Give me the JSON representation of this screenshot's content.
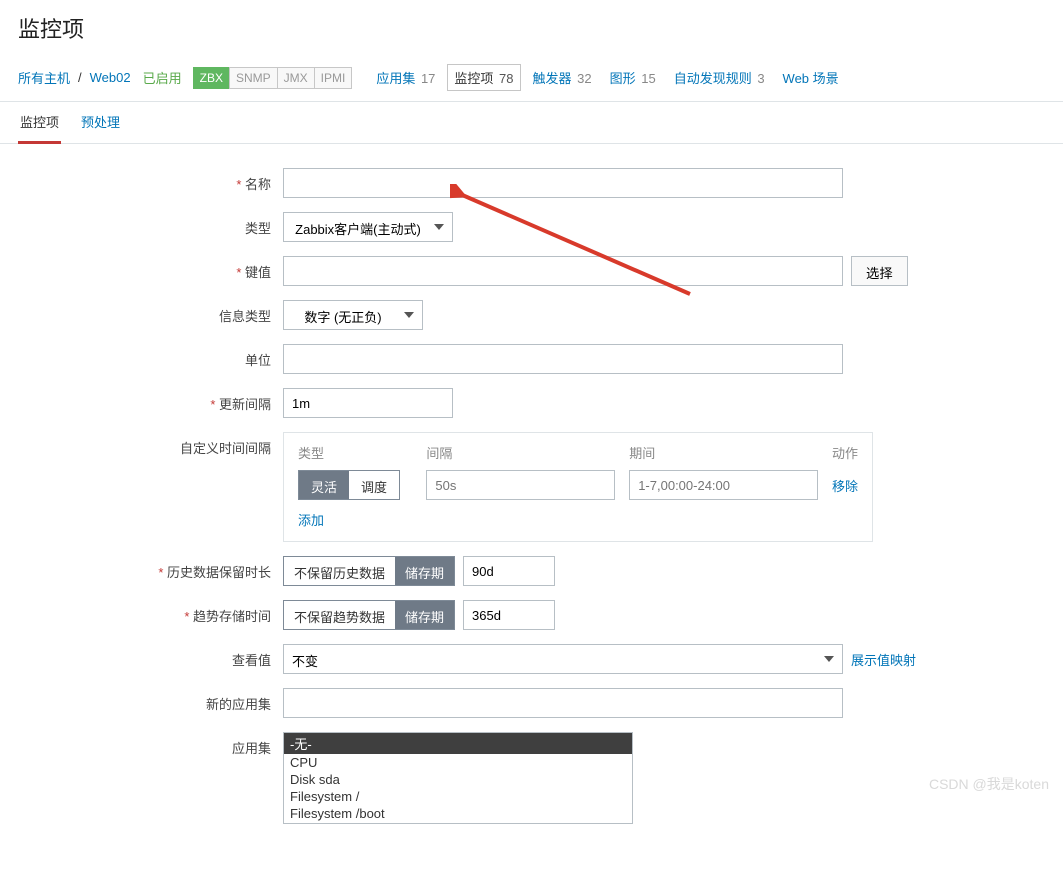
{
  "pageTitle": "监控项",
  "breadcrumb": {
    "allHosts": "所有主机",
    "host": "Web02"
  },
  "enabledLabel": "已启用",
  "protocols": [
    "ZBX",
    "SNMP",
    "JMX",
    "IPMI"
  ],
  "navItems": [
    {
      "label": "应用集",
      "count": "17",
      "active": false
    },
    {
      "label": "监控项",
      "count": "78",
      "active": true
    },
    {
      "label": "触发器",
      "count": "32",
      "active": false
    },
    {
      "label": "图形",
      "count": "15",
      "active": false
    },
    {
      "label": "自动发现规则",
      "count": "3",
      "active": false
    },
    {
      "label": "Web 场景",
      "count": "",
      "active": false
    }
  ],
  "tabs": {
    "item": "监控项",
    "preproc": "预处理"
  },
  "labels": {
    "name": "名称",
    "type": "类型",
    "key": "键值",
    "infoType": "信息类型",
    "units": "单位",
    "updateInterval": "更新间隔",
    "customIntervals": "自定义时间间隔",
    "history": "历史数据保留时长",
    "trends": "趋势存储时间",
    "viewValue": "查看值",
    "newApp": "新的应用集",
    "appSet": "应用集"
  },
  "typeValue": "Zabbix客户端(主动式)",
  "selectBtn": "选择",
  "infoTypeValue": "数字 (无正负)",
  "updateIntervalValue": "1m",
  "intervals": {
    "head": {
      "type": "类型",
      "interval": "间隔",
      "period": "期间",
      "action": "动作"
    },
    "toggle": {
      "flex": "灵活",
      "sched": "调度"
    },
    "placeholders": {
      "interval": "50s",
      "period": "1-7,00:00-24:00"
    },
    "remove": "移除",
    "add": "添加"
  },
  "history": {
    "noKeep": "不保留历史数据",
    "storage": "储存期",
    "value": "90d"
  },
  "trends": {
    "noKeep": "不保留趋势数据",
    "storage": "储存期",
    "value": "365d"
  },
  "viewValue": {
    "asIs": "不变",
    "showMap": "展示值映射"
  },
  "apps": [
    "-无-",
    "CPU",
    "Disk sda",
    "Filesystem /",
    "Filesystem /boot"
  ],
  "watermark": "CSDN @我是koten"
}
